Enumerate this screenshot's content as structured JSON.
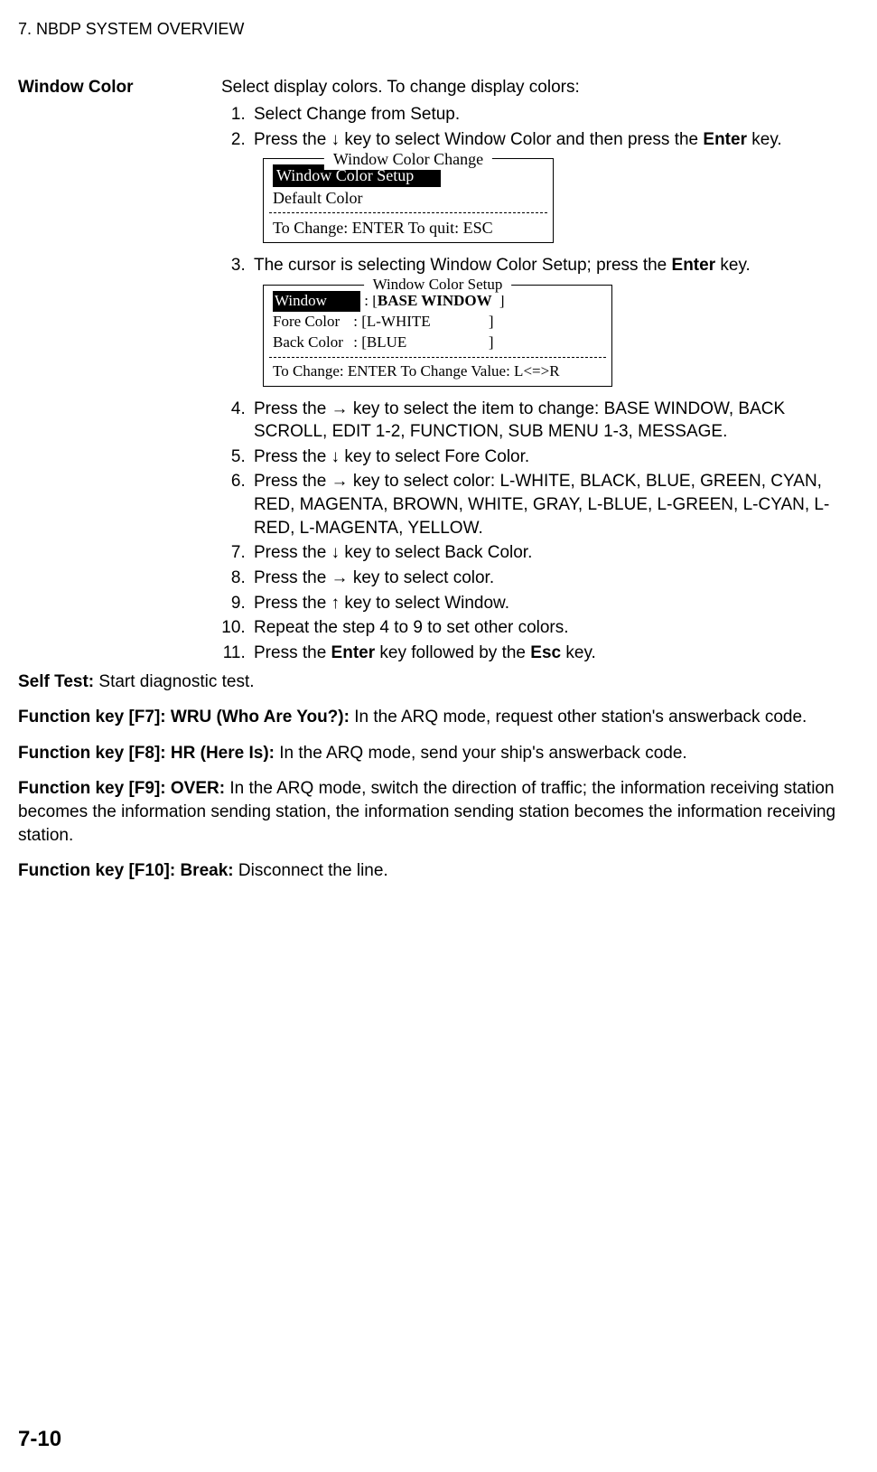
{
  "header": "7.  NBDP SYSTEM OVERVIEW",
  "section_label": "Window Color",
  "intro": "Select display colors. To change display colors:",
  "steps_a": {
    "s1": "Select Change from Setup.",
    "s2_pre": "Press the ↓ key to select Window Color and then press the ",
    "s2_key": "Enter",
    "s2_post": " key."
  },
  "dialog1": {
    "title": "Window Color Change",
    "item1": "Window Color Setup",
    "item2": "Default Color",
    "hint": "To Change: ENTER  To quit: ESC"
  },
  "steps_b": {
    "s3_pre": "The cursor is selecting Window Color Setup; press the ",
    "s3_key": "Enter",
    "s3_post": " key."
  },
  "dialog2": {
    "title": "Window Color Setup",
    "r1_label": "Window",
    "r1_val": "BASE WINDOW",
    "r2_label": "Fore Color",
    "r2_val": "L-WHITE",
    "r3_label": "Back Color",
    "r3_val": "BLUE",
    "hint": "To Change: ENTER    To Change Value: L<=>R"
  },
  "steps_c": {
    "s4": "Press the → key to select the item to change: BASE WINDOW, BACK SCROLL, EDIT 1-2, FUNCTION, SUB MENU 1-3, MESSAGE.",
    "s5": "Press the ↓ key to select Fore Color.",
    "s6": "Press the → key to select color: L-WHITE, BLACK, BLUE, GREEN, CYAN, RED, MAGENTA, BROWN, WHITE, GRAY, L-BLUE, L-GREEN, L-CYAN, L-RED, L-MAGENTA, YELLOW.",
    "s7": "Press the ↓ key to select Back Color.",
    "s8": "Press the → key to select color.",
    "s9": "Press the ↑ key to select Window.",
    "s10": "Repeat the step 4 to 9 to set other colors.",
    "s11_pre": "Press the ",
    "s11_k1": "Enter",
    "s11_mid": " key followed by the ",
    "s11_k2": "Esc",
    "s11_post": " key."
  },
  "selftest_label": "Self Test: ",
  "selftest_text": "Start diagnostic test.",
  "f7_label": "Function key [F7]: WRU (Who Are You?): ",
  "f7_text": "In the ARQ mode, request other station's answerback code.",
  "f8_label": "Function key [F8]: HR (Here Is): ",
  "f8_text": "In the ARQ mode, send your ship's answerback code.",
  "f9_label": "Function key [F9]: OVER: ",
  "f9_text": "In the ARQ mode, switch the direction of traffic; the information receiving station becomes the information sending station, the information sending station becomes the information receiving station.",
  "f10_label": "Function key [F10]: Break: ",
  "f10_text": "Disconnect the line.",
  "page_num": "7-10"
}
